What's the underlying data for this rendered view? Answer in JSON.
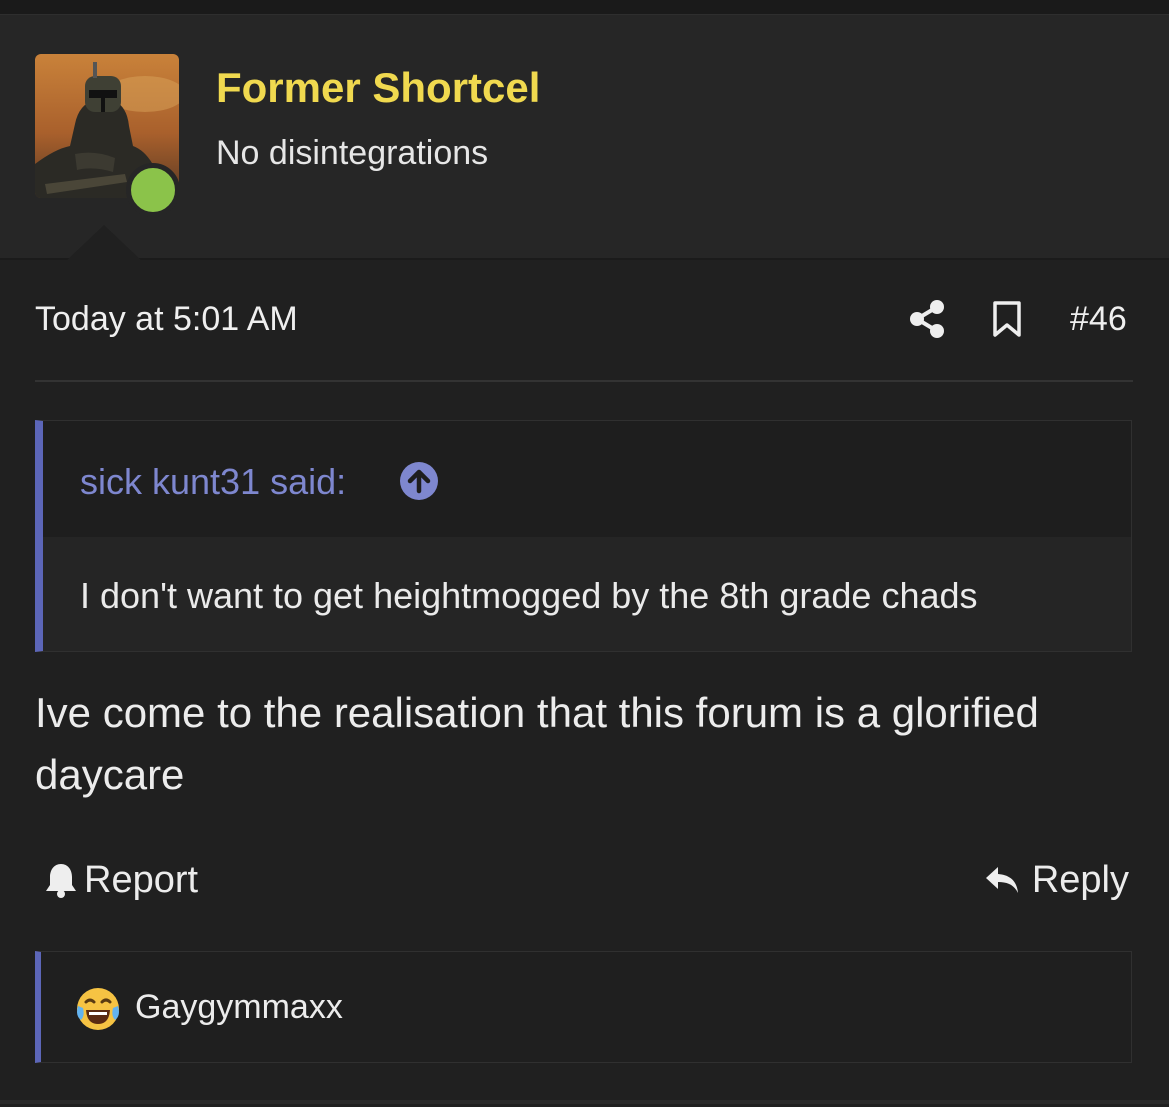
{
  "post": {
    "author": {
      "name": "Former Shortcel",
      "title": "No disintegrations",
      "online": true
    },
    "date": "Today at 5:01 AM",
    "number": "#46",
    "quote": {
      "author_label": "sick kunt31 said:",
      "text": "I don't want to get heightmogged by the 8th grade chads"
    },
    "message": "Ive come to the realisation that this forum is a glorified daycare",
    "actions": {
      "report": "Report",
      "reply": "Reply"
    },
    "reaction": {
      "emoji": "laughing-crying-emoji",
      "user": "Gaygymmaxx"
    }
  },
  "colors": {
    "background": "#202020",
    "header": "#262626",
    "username": "#f0d94f",
    "quote_accent": "#5c66b8",
    "quote_author": "#7e87cf",
    "online": "#8bc34a"
  }
}
